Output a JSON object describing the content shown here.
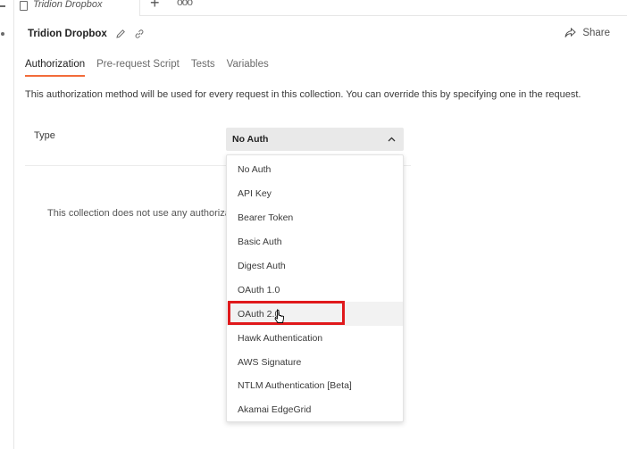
{
  "tab": {
    "label": "Tridion Dropbox"
  },
  "header": {
    "title": "Tridion Dropbox",
    "share_label": "Share"
  },
  "subtabs": [
    {
      "label": "Authorization",
      "active": true
    },
    {
      "label": "Pre-request Script",
      "active": false
    },
    {
      "label": "Tests",
      "active": false
    },
    {
      "label": "Variables",
      "active": false
    }
  ],
  "description": "This authorization method will be used for every request in this collection. You can override this by specifying one in the request.",
  "type_label": "Type",
  "select": {
    "value": "No Auth"
  },
  "no_auth_message": "This collection does not use any authoriza",
  "menu": {
    "items": [
      "No Auth",
      "API Key",
      "Bearer Token",
      "Basic Auth",
      "Digest Auth",
      "OAuth 1.0",
      "OAuth 2.0",
      "Hawk Authentication",
      "AWS Signature",
      "NTLM Authentication [Beta]",
      "Akamai EdgeGrid"
    ],
    "hovered_item": "OAuth 2.0"
  },
  "colors": {
    "accent_tab_underline": "#f26b3a",
    "highlight_box": "#e0191c",
    "select_background": "#e9e9e9"
  },
  "icons": [
    "file-icon",
    "plus-icon",
    "more-icon",
    "edit-icon",
    "link-icon",
    "share-icon",
    "chevron-up-icon",
    "cursor-icon"
  ]
}
